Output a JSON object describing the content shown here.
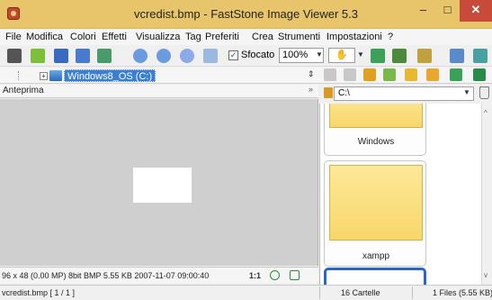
{
  "window": {
    "title": "vcredist.bmp  -  FastStone Image Viewer 5.3",
    "minimize_glyph": "–",
    "maximize_glyph": "□",
    "close_glyph": "✕"
  },
  "menu": {
    "items": [
      {
        "label": "File"
      },
      {
        "label": "Modifica"
      },
      {
        "label": "Colori"
      },
      {
        "label": "Effetti"
      },
      {
        "label": "Visualizza"
      },
      {
        "label": "Tag"
      },
      {
        "label": "Preferiti"
      },
      {
        "label": "Crea"
      },
      {
        "label": "Strumenti"
      },
      {
        "label": "Impostazioni"
      },
      {
        "label": "?"
      }
    ]
  },
  "toolbar": {
    "smooth_checked_glyph": "✓",
    "smooth_label": "Sfocato",
    "zoom_value": "100%",
    "hand_glyph": "✋",
    "dropdown_glyph": "▼",
    "icons": [
      "camera-icon",
      "folder-open-icon",
      "save-icon",
      "save-as-icon",
      "print-icon",
      "zoom-in-icon",
      "zoom-out-icon",
      "fit-icon",
      "fullscreen-icon",
      "compare-icon",
      "edit-icon",
      "slideshow-icon",
      "fit-window-icon"
    ]
  },
  "folder_tree": {
    "expand_glyph": "+",
    "selected_drive": "Windows8_OS (C:)",
    "sort_glyph": "⇕",
    "nav_icons": [
      "back-icon",
      "forward-icon",
      "up-folder-icon",
      "favorite-folder-icon",
      "new-folder-icon",
      "folder-icon",
      "refresh-icon",
      "settings-icon"
    ]
  },
  "preview": {
    "header": "Anteprima",
    "collapse_glyph": "»",
    "image_info": "96 x 48 (0.00 MP)  8bit  BMP  5.55 KB  2007-11-07 09:00:40",
    "ratio": "1:1"
  },
  "browser": {
    "path": "C:\\",
    "path_dropdown_glyph": "▼",
    "thumbnails": [
      {
        "label": "Windows"
      },
      {
        "label": "xampp"
      },
      {
        "label": ""
      }
    ],
    "scroll_up_glyph": "^",
    "scroll_down_glyph": "v"
  },
  "status": {
    "file": "vcredist.bmp [ 1 / 1 ]",
    "folders": "16 Cartelle",
    "files": "1 Files (5.55 KB)"
  },
  "colors": {
    "titlebar": "#e8c56a",
    "close_button": "#c74a3a",
    "selection": "#3b7fd4",
    "folder_fill": "#f8d76a",
    "selected_thumb_border": "#2a66c8",
    "preview_background": "#cfcfcf"
  }
}
